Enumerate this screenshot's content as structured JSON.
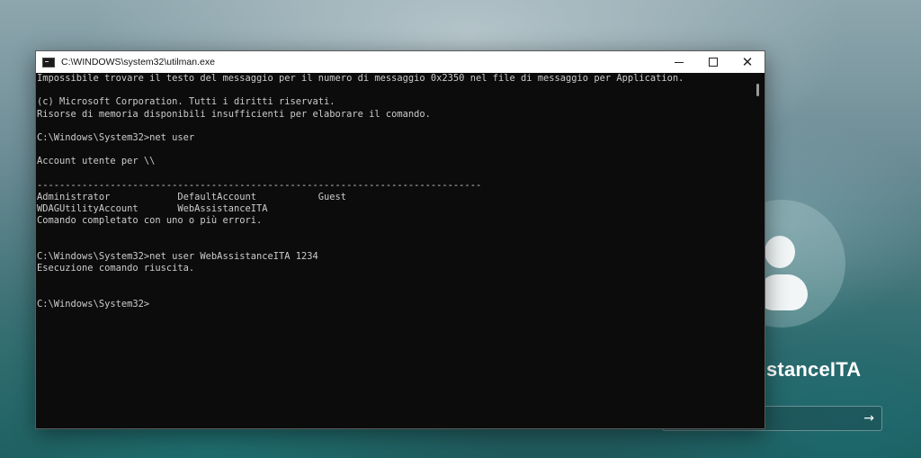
{
  "lock_screen": {
    "username_partial": "stanceITA",
    "submit_arrow": "→"
  },
  "console": {
    "title": "C:\\WINDOWS\\system32\\utilman.exe",
    "controls": {
      "minimize": "minimize-icon",
      "maximize": "maximize-icon",
      "close": "✕"
    },
    "lines": [
      "Impossibile trovare il testo del messaggio per il numero di messaggio 0x2350 nel file di messaggio per Application.",
      "",
      "(c) Microsoft Corporation. Tutti i diritti riservati.",
      "Risorse di memoria disponibili insufficienti per elaborare il comando.",
      "",
      "C:\\Windows\\System32>net user",
      "",
      "Account utente per \\\\",
      "",
      "-------------------------------------------------------------------------------",
      "Administrator            DefaultAccount           Guest",
      "WDAGUtilityAccount       WebAssistanceITA",
      "Comando completato con uno o più errori.",
      "",
      "",
      "C:\\Windows\\System32>net user WebAssistanceITA 1234",
      "Esecuzione comando riuscita.",
      "",
      "",
      "C:\\Windows\\System32>"
    ]
  }
}
